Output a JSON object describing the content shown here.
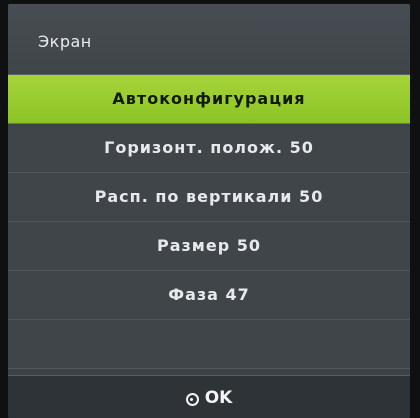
{
  "header": {
    "title": "Экран"
  },
  "menu": {
    "items": [
      {
        "label": "Автоконфигурация"
      },
      {
        "label": "Горизонт. полож. 50"
      },
      {
        "label": "Расп. по вертикали 50"
      },
      {
        "label": "Размер 50"
      },
      {
        "label": "Фаза 47"
      }
    ],
    "selected_index": 0
  },
  "footer": {
    "ok_label": "OK",
    "ok_icon": "ok-button-icon"
  },
  "colors": {
    "accent": "#97cc2f",
    "panel": "#3f4549",
    "text": "#e6eaec"
  }
}
